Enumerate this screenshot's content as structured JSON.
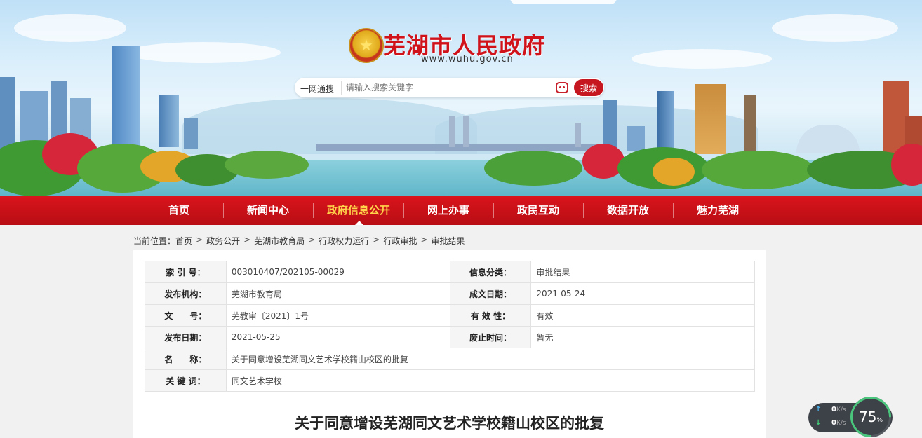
{
  "header": {
    "site_title": "芜湖市人民政府",
    "site_domain": "www.wuhu.gov.cn",
    "emblem_icon": "national-emblem-icon"
  },
  "search": {
    "scope_label": "一网通搜",
    "placeholder": "请输入搜索关键字",
    "button_label": "搜索"
  },
  "nav": {
    "items": [
      {
        "label": "首页"
      },
      {
        "label": "新闻中心"
      },
      {
        "label": "政府信息公开"
      },
      {
        "label": "网上办事"
      },
      {
        "label": "政民互动"
      },
      {
        "label": "数据开放"
      },
      {
        "label": "魅力芜湖"
      }
    ],
    "active_index": 2,
    "active_color": "#ffd44a",
    "bar_color": "#c6111a"
  },
  "breadcrumb": {
    "prefix": "当前位置：",
    "items": [
      "首页",
      "政务公开",
      "芜湖市教育局",
      "行政权力运行",
      "行政审批",
      "审批结果"
    ],
    "separator": ">"
  },
  "meta": {
    "index_no_label": "索 引 号：",
    "index_no": "003010407/202105-00029",
    "category_label": "信息分类：",
    "category": "审批结果",
    "publisher_label": "发布机构：",
    "publisher": "芜湖市教育局",
    "created_label": "成文日期：",
    "created": "2021-05-24",
    "doc_no_label": "文　　号：",
    "doc_no": "芜教审〔2021〕1号",
    "validity_label": "有 效 性：",
    "validity": "有效",
    "published_label": "发布日期：",
    "published": "2021-05-25",
    "expire_label": "废止时间：",
    "expire": "暂无",
    "name_label": "名　　称：",
    "name": "关于同意增设芜湖同文艺术学校籍山校区的批复",
    "keywords_label": "关 键 词：",
    "keywords": "同文艺术学校"
  },
  "document": {
    "title": "关于同意增设芜湖同文艺术学校籍山校区的批复"
  },
  "speed_widget": {
    "upload": "0",
    "download": "0",
    "unit": "K/s",
    "percent": "75",
    "percent_unit": "%"
  }
}
